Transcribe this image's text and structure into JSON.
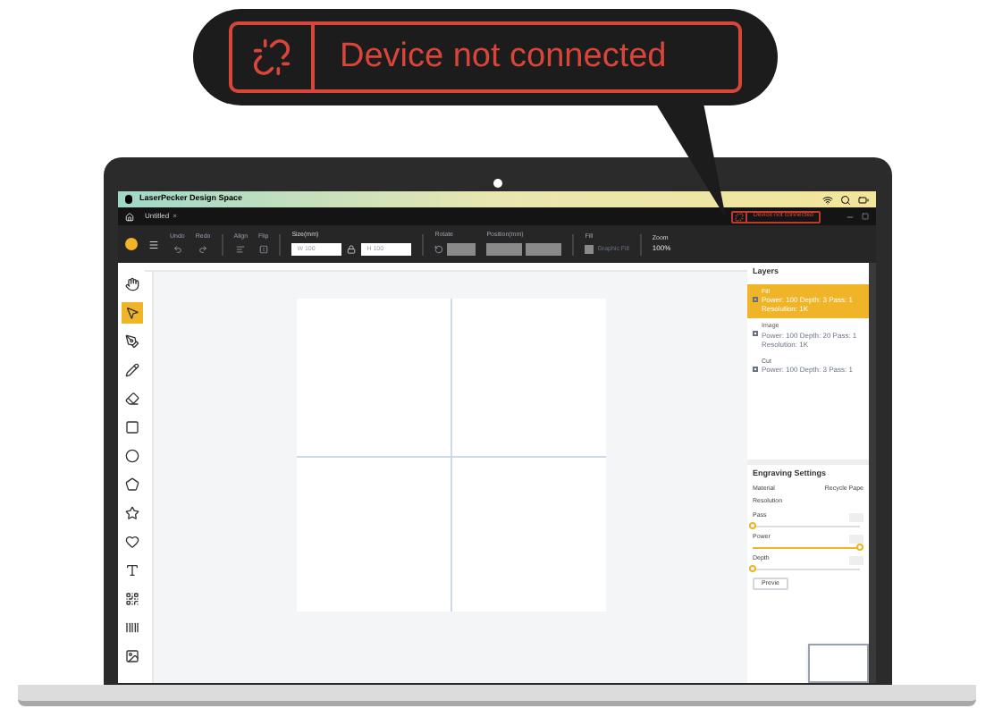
{
  "callout": {
    "message": "Device not connected"
  },
  "app": {
    "title": "LaserPecker Design Space",
    "tab": "Untitled",
    "tab_close": "×",
    "toolbar": {
      "undo": "Undo",
      "redo": "Redo",
      "align": "Align",
      "flip": "Flip",
      "size_label": "Size(mm)",
      "width": "W 100",
      "height": "H 100",
      "rotate": "Rotate",
      "position_label": "Position(mm)",
      "fill_label": "Fill",
      "graphic_fill": "Graphic Fill",
      "graphic_fill_checked": false,
      "zoom_label": "Zoom",
      "zoom": "100%"
    },
    "device_status": "Device not connected",
    "tools": [
      {
        "kind": "hand",
        "selected": false
      },
      {
        "kind": "select",
        "selected": true
      },
      {
        "kind": "pen",
        "selected": false
      },
      {
        "kind": "pencil",
        "selected": false
      },
      {
        "kind": "eraser",
        "selected": false
      },
      {
        "kind": "square",
        "selected": false
      },
      {
        "kind": "circle",
        "selected": false
      },
      {
        "kind": "polygon",
        "selected": false
      },
      {
        "kind": "star",
        "selected": false
      },
      {
        "kind": "heart",
        "selected": false
      },
      {
        "kind": "text",
        "selected": false
      },
      {
        "kind": "qrcode",
        "selected": false
      },
      {
        "kind": "barcode",
        "selected": false
      },
      {
        "kind": "image",
        "selected": false
      }
    ],
    "layers": {
      "title": "Layers",
      "items": [
        {
          "name": "Fill",
          "details": "Power: 100 Depth: 3 Pass: 1",
          "resolution": "Resolution: 1K",
          "selected": true
        },
        {
          "name": "Image",
          "details": "Power: 100 Depth: 20 Pass: 1",
          "resolution": "Resolution: 1K",
          "selected": false
        },
        {
          "name": "Cut",
          "details": "Power: 100 Depth: 3 Pass: 1",
          "selected": false
        }
      ]
    },
    "engraving": {
      "title": "Engraving Settings",
      "rows": [
        {
          "kind": "value",
          "label": "Material",
          "value": "Recycle Pape"
        },
        {
          "kind": "label",
          "label": "Resolution"
        },
        {
          "kind": "slider",
          "label": "Pass",
          "level": 0
        },
        {
          "kind": "slider",
          "label": "Power",
          "level": 1
        },
        {
          "kind": "slider",
          "label": "Depth",
          "level": 0
        }
      ],
      "preview": "Previe"
    }
  }
}
